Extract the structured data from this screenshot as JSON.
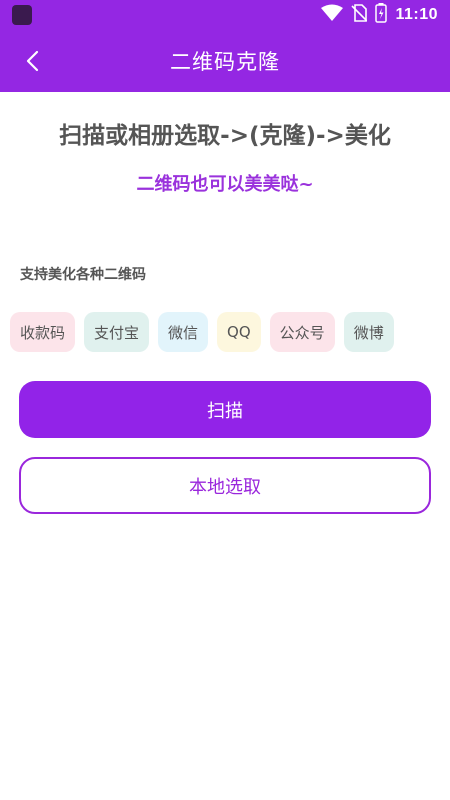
{
  "status_bar": {
    "time": "11:10",
    "icons": [
      "app-icon",
      "wifi-icon",
      "no-sim-icon",
      "battery-icon"
    ]
  },
  "header": {
    "title": "二维码克隆",
    "back_icon": "chevron-left-icon"
  },
  "main": {
    "headline": "扫描或相册选取->(克隆)->美化",
    "subline": "二维码也可以美美哒~",
    "support_label": "支持美化各种二维码",
    "tags": [
      {
        "label": "收款码",
        "color": "#fce4ea"
      },
      {
        "label": "支付宝",
        "color": "#e0f1ee"
      },
      {
        "label": "微信",
        "color": "#e2f4fb"
      },
      {
        "label": "QQ",
        "color": "#fdf7de"
      },
      {
        "label": "公众号",
        "color": "#fce4ea"
      },
      {
        "label": "微博",
        "color": "#e0f1ee"
      }
    ],
    "scan_button": "扫描",
    "local_button": "本地选取"
  },
  "colors": {
    "brand": "#9427e3",
    "button_primary": "#9223e8",
    "accent_text": "#9a32dc"
  }
}
